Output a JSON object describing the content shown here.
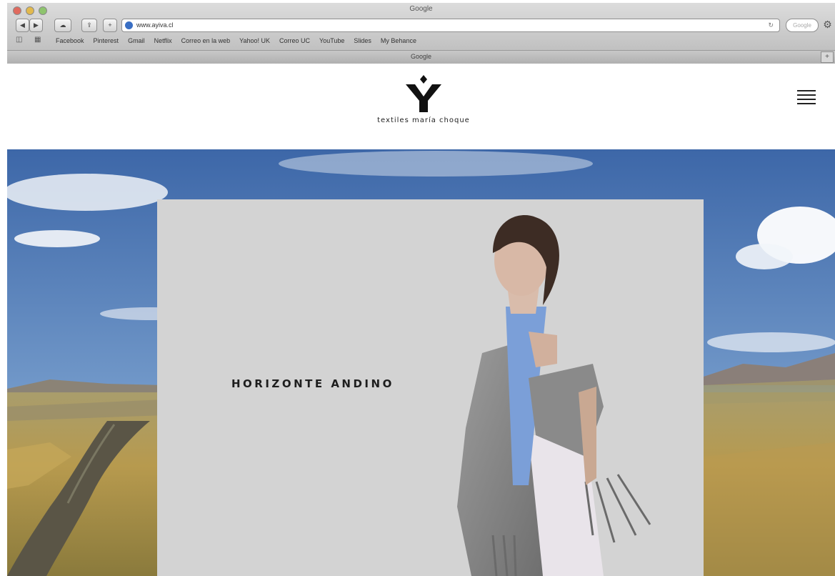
{
  "browser": {
    "window_title": "Google",
    "address": "www.ayiva.cl",
    "search_placeholder": "Google",
    "settings_icon": "gear-icon",
    "bookmarks_icons": [
      "reading-list-icon",
      "bookmarks-grid-icon"
    ],
    "bookmarks": [
      "Facebook",
      "Pinterest",
      "Gmail",
      "Netflix",
      "Correo en la web",
      "Yahoo! UK",
      "Correo UC",
      "YouTube",
      "Slides",
      "My Behance"
    ],
    "tab_title": "Google",
    "new_tab_label": "+"
  },
  "site": {
    "logo_alt": "Y",
    "tagline": "textiles maría choque",
    "menu_icon": "hamburger-menu-icon"
  },
  "hero": {
    "caption": "HORIZONTE ANDINO",
    "slides": 4,
    "active_slide": 1
  },
  "colors": {
    "accent_blue": "#7b9fd8",
    "card_background": "#d3d3d3",
    "sky": "#4e78b8",
    "grass": "#b59a52"
  }
}
